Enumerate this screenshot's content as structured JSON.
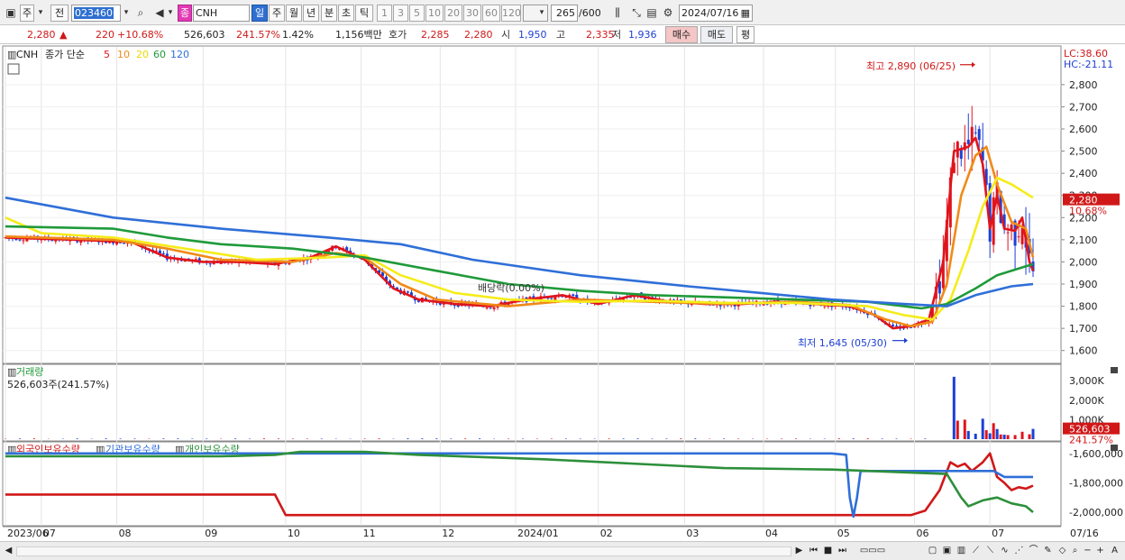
{
  "toolbar": {
    "freq_label": "주",
    "compare_label": "전",
    "stock_code": "023460",
    "type_badge": "종",
    "stock_name": "CNH",
    "periods": [
      "일",
      "주",
      "월",
      "년",
      "분",
      "초",
      "틱"
    ],
    "selected_period": "일",
    "intervals": [
      "1",
      "3",
      "5",
      "10",
      "20",
      "30",
      "60",
      "120"
    ],
    "count_display": "265",
    "count_max": "/600",
    "date": "2024/07/16"
  },
  "quote": {
    "price": "2,280",
    "change_arrow": "▲",
    "change": "220",
    "change_pct": "+10.68%",
    "volume": "526,603",
    "volume_ratio": "241.57%",
    "turnover": "1.42%",
    "amount": "1,156백만",
    "hoga_label": "호가",
    "ask": "2,285",
    "bid": "2,280",
    "open_label": "시",
    "open": "1,950",
    "high_label": "고",
    "high": "2,335",
    "low_label": "저",
    "low": "1,936",
    "buy_label": "매수",
    "sell_label": "매도",
    "flat_label": "평"
  },
  "chart_data": {
    "type": "candlestick",
    "stock": "CNH",
    "legend": {
      "name": "CNH",
      "indicator": "종가 단순",
      "ma_periods": [
        {
          "period": "5",
          "color": "#e0141c"
        },
        {
          "period": "10",
          "color": "#f08a18"
        },
        {
          "period": "20",
          "color": "#f5ec1a"
        },
        {
          "period": "60",
          "color": "#1f9a3a"
        },
        {
          "period": "120",
          "color": "#2f6fd8"
        }
      ]
    },
    "price_axis": {
      "ylim": [
        1550,
        2950
      ],
      "ticks": [
        "1,600",
        "1,700",
        "1,800",
        "1,900",
        "2,000",
        "2,100",
        "2,200",
        "2,300",
        "2,400",
        "2,500",
        "2,600",
        "2,700",
        "2,800"
      ],
      "tick_values": [
        1600,
        1700,
        1800,
        1900,
        2000,
        2100,
        2200,
        2300,
        2400,
        2500,
        2600,
        2700,
        2800
      ],
      "lc_label": "LC:38.60",
      "hc_label": "HC:-21.11",
      "current_label": "2,280",
      "current_pct_label": "10.68%",
      "current_value": 2280
    },
    "annotations": {
      "high_label": "최고 2,890 (06/25)",
      "low_label": "최저 1,645 (05/30)",
      "dividend_label": "배당락(0.00%)"
    },
    "x_axis": {
      "labels": [
        "2023/06",
        "07",
        "08",
        "09",
        "10",
        "11",
        "12",
        "2024/01",
        "02",
        "03",
        "04",
        "05",
        "06",
        "07",
        "07/16"
      ],
      "label_indices": [
        0,
        10,
        31,
        55,
        78,
        99,
        121,
        142,
        165,
        189,
        211,
        231,
        253,
        274,
        272
      ]
    },
    "ma_series": [
      {
        "name": "5",
        "color": "#e0141c",
        "points": [
          [
            0,
            2110
          ],
          [
            20,
            2100
          ],
          [
            35,
            2090
          ],
          [
            45,
            2020
          ],
          [
            55,
            2000
          ],
          [
            65,
            2000
          ],
          [
            75,
            1990
          ],
          [
            85,
            2020
          ],
          [
            92,
            2070
          ],
          [
            100,
            2010
          ],
          [
            108,
            1880
          ],
          [
            115,
            1830
          ],
          [
            125,
            1810
          ],
          [
            135,
            1800
          ],
          [
            145,
            1830
          ],
          [
            155,
            1850
          ],
          [
            165,
            1810
          ],
          [
            175,
            1850
          ],
          [
            185,
            1820
          ],
          [
            195,
            1810
          ],
          [
            205,
            1810
          ],
          [
            215,
            1820
          ],
          [
            225,
            1810
          ],
          [
            235,
            1800
          ],
          [
            242,
            1760
          ],
          [
            247,
            1700
          ],
          [
            252,
            1710
          ],
          [
            257,
            1740
          ],
          [
            261,
            2000
          ],
          [
            264,
            2500
          ],
          [
            268,
            2520
          ],
          [
            270,
            2560
          ],
          [
            272,
            2440
          ],
          [
            274,
            2150
          ],
          [
            276,
            2300
          ],
          [
            278,
            2150
          ],
          [
            281,
            2140
          ],
          [
            283,
            2200
          ],
          [
            285,
            2000
          ],
          [
            286,
            1960
          ]
        ]
      },
      {
        "name": "10",
        "color": "#f08a18",
        "points": [
          [
            0,
            2115
          ],
          [
            30,
            2100
          ],
          [
            45,
            2060
          ],
          [
            60,
            2010
          ],
          [
            80,
            2000
          ],
          [
            92,
            2040
          ],
          [
            100,
            2020
          ],
          [
            110,
            1900
          ],
          [
            120,
            1830
          ],
          [
            140,
            1800
          ],
          [
            160,
            1830
          ],
          [
            180,
            1820
          ],
          [
            200,
            1810
          ],
          [
            220,
            1820
          ],
          [
            235,
            1805
          ],
          [
            245,
            1740
          ],
          [
            252,
            1710
          ],
          [
            258,
            1730
          ],
          [
            262,
            1900
          ],
          [
            266,
            2300
          ],
          [
            270,
            2480
          ],
          [
            273,
            2520
          ],
          [
            276,
            2350
          ],
          [
            280,
            2180
          ],
          [
            284,
            2150
          ],
          [
            286,
            2020
          ]
        ]
      },
      {
        "name": "20",
        "color": "#f5ec1a",
        "points": [
          [
            0,
            2200
          ],
          [
            10,
            2130
          ],
          [
            30,
            2110
          ],
          [
            50,
            2060
          ],
          [
            70,
            2010
          ],
          [
            90,
            2020
          ],
          [
            100,
            2030
          ],
          [
            110,
            1940
          ],
          [
            125,
            1860
          ],
          [
            140,
            1830
          ],
          [
            160,
            1820
          ],
          [
            180,
            1825
          ],
          [
            200,
            1815
          ],
          [
            220,
            1815
          ],
          [
            240,
            1800
          ],
          [
            250,
            1760
          ],
          [
            258,
            1740
          ],
          [
            263,
            1830
          ],
          [
            268,
            2050
          ],
          [
            272,
            2250
          ],
          [
            276,
            2380
          ],
          [
            280,
            2350
          ],
          [
            283,
            2320
          ],
          [
            286,
            2290
          ]
        ]
      },
      {
        "name": "60",
        "color": "#1f9a3a",
        "points": [
          [
            0,
            2160
          ],
          [
            30,
            2150
          ],
          [
            45,
            2110
          ],
          [
            60,
            2080
          ],
          [
            80,
            2060
          ],
          [
            100,
            2020
          ],
          [
            120,
            1960
          ],
          [
            140,
            1900
          ],
          [
            160,
            1870
          ],
          [
            180,
            1850
          ],
          [
            200,
            1840
          ],
          [
            220,
            1830
          ],
          [
            240,
            1820
          ],
          [
            255,
            1790
          ],
          [
            262,
            1810
          ],
          [
            270,
            1880
          ],
          [
            276,
            1940
          ],
          [
            282,
            1970
          ],
          [
            286,
            1990
          ]
        ]
      },
      {
        "name": "120",
        "color": "#2f6fd8",
        "points": [
          [
            0,
            2290
          ],
          [
            30,
            2200
          ],
          [
            60,
            2150
          ],
          [
            90,
            2110
          ],
          [
            110,
            2080
          ],
          [
            130,
            2010
          ],
          [
            160,
            1940
          ],
          [
            190,
            1890
          ],
          [
            210,
            1860
          ],
          [
            230,
            1830
          ],
          [
            250,
            1810
          ],
          [
            262,
            1800
          ],
          [
            270,
            1850
          ],
          [
            280,
            1890
          ],
          [
            286,
            1900
          ]
        ]
      }
    ],
    "volume_panel": {
      "title": "거래량",
      "current_label": "526,603주(241.57%)",
      "ticks": [
        "1,000K",
        "2,000K",
        "3,000K"
      ],
      "tick_values": [
        1000000,
        2000000,
        3000000
      ],
      "ylim": [
        0,
        3700000
      ],
      "current_value_label": "526,603",
      "current_pct_label": "241.57%",
      "current_value": 526603,
      "bars": [
        [
          264,
          3200000
        ],
        [
          265,
          950000
        ],
        [
          267,
          1000000
        ],
        [
          268,
          420000
        ],
        [
          270,
          280000
        ],
        [
          272,
          1050000
        ],
        [
          273,
          460000
        ],
        [
          274,
          300000
        ],
        [
          275,
          820000
        ],
        [
          276,
          520000
        ],
        [
          277,
          240000
        ],
        [
          278,
          230000
        ],
        [
          279,
          210000
        ],
        [
          281,
          210000
        ],
        [
          283,
          380000
        ],
        [
          285,
          250000
        ],
        [
          286,
          526603
        ]
      ]
    },
    "holdings_panel": {
      "legend": [
        "외국인보유수량",
        "기관보유수량",
        "개인보유수량"
      ],
      "ticks": [
        "-1,600,000",
        "-1,800,000",
        "-2,000,000"
      ],
      "tick_values": [
        -1600000,
        -1800000,
        -2000000
      ],
      "ylim": [
        -2080000,
        -1540000
      ],
      "series": [
        {
          "name": "외국인보유수량",
          "color": "#d01818",
          "points": [
            [
              0,
              -1880000
            ],
            [
              60,
              -1880000
            ],
            [
              75,
              -1880000
            ],
            [
              78,
              -2020000
            ],
            [
              120,
              -2020000
            ],
            [
              200,
              -2020000
            ],
            [
              252,
              -2020000
            ],
            [
              256,
              -1990000
            ],
            [
              260,
              -1850000
            ],
            [
              263,
              -1660000
            ],
            [
              265,
              -1690000
            ],
            [
              267,
              -1670000
            ],
            [
              269,
              -1720000
            ],
            [
              272,
              -1660000
            ],
            [
              274,
              -1600000
            ],
            [
              276,
              -1760000
            ],
            [
              278,
              -1800000
            ],
            [
              280,
              -1850000
            ],
            [
              282,
              -1830000
            ],
            [
              284,
              -1840000
            ],
            [
              286,
              -1820000
            ]
          ]
        },
        {
          "name": "기관보유수량",
          "color": "#2f6fd8",
          "points": [
            [
              0,
              -1600000
            ],
            [
              150,
              -1600000
            ],
            [
              230,
              -1600000
            ],
            [
              234,
              -1610000
            ],
            [
              235,
              -1900000
            ],
            [
              236,
              -2030000
            ],
            [
              237,
              -1900000
            ],
            [
              238,
              -1720000
            ],
            [
              260,
              -1720000
            ],
            [
              275,
              -1720000
            ],
            [
              278,
              -1760000
            ],
            [
              286,
              -1760000
            ]
          ]
        },
        {
          "name": "개인보유수량",
          "color": "#2d8f3a",
          "points": [
            [
              0,
              -1620000
            ],
            [
              60,
              -1620000
            ],
            [
              75,
              -1610000
            ],
            [
              82,
              -1590000
            ],
            [
              100,
              -1590000
            ],
            [
              115,
              -1610000
            ],
            [
              150,
              -1640000
            ],
            [
              200,
              -1700000
            ],
            [
              230,
              -1710000
            ],
            [
              262,
              -1740000
            ],
            [
              266,
              -1900000
            ],
            [
              268,
              -1960000
            ],
            [
              272,
              -1920000
            ],
            [
              276,
              -1900000
            ],
            [
              280,
              -1940000
            ],
            [
              284,
              -1960000
            ],
            [
              286,
              -2000000
            ]
          ]
        }
      ]
    }
  }
}
